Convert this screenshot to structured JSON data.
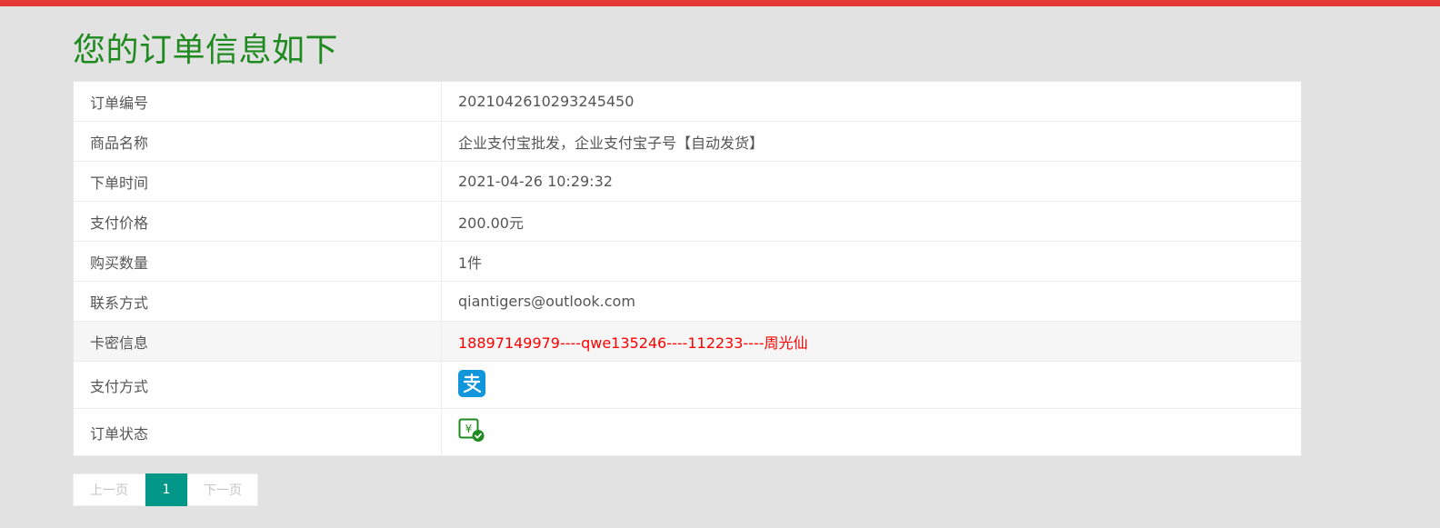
{
  "colors": {
    "accent_bar": "#e53935",
    "title": "#1f8a1f",
    "card_info": "#ff0000",
    "active_page": "#009688"
  },
  "title": "您的订单信息如下",
  "order": {
    "rows": [
      {
        "label": "订单编号",
        "value": "2021042610293245450"
      },
      {
        "label": "商品名称",
        "value": "企业支付宝批发，企业支付宝子号【自动发货】"
      },
      {
        "label": "下单时间",
        "value": "2021-04-26 10:29:32"
      },
      {
        "label": "支付价格",
        "value": "200.00元"
      },
      {
        "label": "购买数量",
        "value": "1件"
      },
      {
        "label": "联系方式",
        "value": "qiantigers@outlook.com"
      },
      {
        "label": "卡密信息",
        "value": "18897149979----qwe135246----112233----周光仙"
      }
    ],
    "payment_method": {
      "label": "支付方式",
      "icon": "alipay-icon"
    },
    "order_status": {
      "label": "订单状态",
      "icon": "paid-check-icon"
    }
  },
  "pagination": {
    "prev": "上一页",
    "current": "1",
    "next": "下一页"
  }
}
